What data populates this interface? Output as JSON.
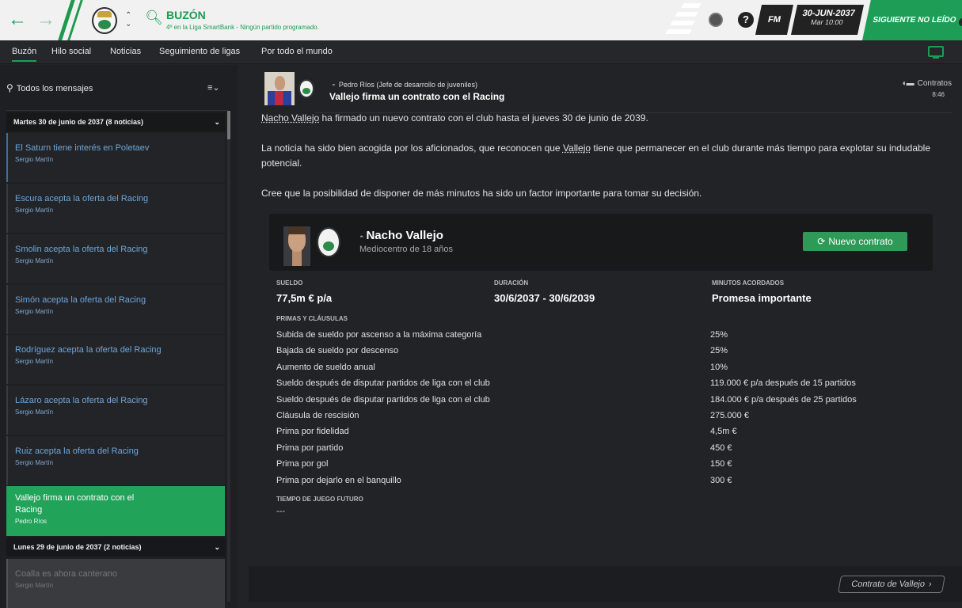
{
  "topbar": {
    "title": "BUZÓN",
    "subtitle": "4º en la Liga SmartBank - Ningún partido programado.",
    "fm_label": "FM",
    "date": "30-JUN-2037",
    "time": "Mar 10:00",
    "next_label": "SIGUIENTE NO LEÍDO",
    "accent": "#1a9e52"
  },
  "tabs": [
    {
      "label": "Buzón"
    },
    {
      "label": "Hilo social"
    },
    {
      "label": "Noticias"
    },
    {
      "label": "Seguimiento de ligas"
    },
    {
      "label": "Por todo el mundo"
    }
  ],
  "sidebar": {
    "filter": "Todos los mensajes",
    "groups": [
      {
        "label": "Martes 30 de junio de 2037 (8 noticias)"
      },
      {
        "label": "Lunes 29 de junio de 2037 (2 noticias)"
      }
    ],
    "messages": [
      {
        "title": "El Saturn tiene interés en Poletaev",
        "sender": "Sergio Martín"
      },
      {
        "title": "Escura acepta la oferta del Racing",
        "sender": "Sergio Martín"
      },
      {
        "title": "Smolin acepta la oferta del Racing",
        "sender": "Sergio Martín"
      },
      {
        "title": "Simón acepta la oferta del Racing",
        "sender": "Sergio Martín"
      },
      {
        "title": "Rodríguez acepta la oferta del Racing",
        "sender": "Sergio Martín"
      },
      {
        "title": "Lázaro acepta la oferta del Racing",
        "sender": "Sergio Martín"
      },
      {
        "title": "Ruiz acepta la oferta del Racing",
        "sender": "Sergio Martín"
      },
      {
        "title": "Vallejo firma un contrato con el Racing",
        "sender": "Pedro Ríos"
      },
      {
        "title": "Coalla es ahora canterano",
        "sender": "Sergio Martín"
      }
    ]
  },
  "mail": {
    "sender": "Pedro Ríos  (Jefe de desarrollo de juveniles)",
    "title": "Vallejo firma un contrato con el Racing",
    "tag": "Contratos",
    "time": "8:46",
    "p1_name": "Nacho Vallejo",
    "p1_rest": " ha firmado un nuevo contrato con el club hasta el jueves 30 de junio de 2039.",
    "p2_a": "La noticia ha sido bien acogida por los aficionados, que reconocen que ",
    "p2_name": "Vallejo",
    "p2_b": " tiene que permanecer en el club durante más tiempo para explotar su indudable potencial.",
    "p3": "Cree que la posibilidad de disponer de más minutos ha sido un factor importante para tomar su decisión."
  },
  "contract": {
    "player": "Nacho Vallejo",
    "position": "Mediocentro de 18 años",
    "button": "Nuevo contrato",
    "sueldo_label": "SUELDO",
    "sueldo": "77,5m € p/a",
    "duracion_label": "DURACIÓN",
    "duracion": "30/6/2037 - 30/6/2039",
    "minutos_label": "MINUTOS ACORDADOS",
    "minutos": "Promesa importante",
    "primas_label": "PRIMAS Y CLÁUSULAS",
    "clauses": [
      {
        "name": "Subida de sueldo por ascenso a la máxima categoría",
        "value": "25%"
      },
      {
        "name": "Bajada de sueldo por descenso",
        "value": "25%"
      },
      {
        "name": "Aumento de sueldo anual",
        "value": "10%"
      },
      {
        "name": "Sueldo después de disputar partidos de liga con el club",
        "value": "119.000 € p/a después de 15 partidos"
      },
      {
        "name": "Sueldo después de disputar partidos de liga con el club",
        "value": "184.000 € p/a después de 25 partidos"
      },
      {
        "name": "Cláusula de rescisión",
        "value": "275.000 €"
      },
      {
        "name": "Prima por fidelidad",
        "value": "4,5m €"
      },
      {
        "name": "Prima por partido",
        "value": "450 €"
      },
      {
        "name": "Prima por gol",
        "value": "150 €"
      },
      {
        "name": "Prima por dejarlo en el banquillo",
        "value": "300 €"
      }
    ],
    "tiempo_label": "TIEMPO DE JUEGO FUTURO",
    "tiempo": "---",
    "link": "Contrato de Vallejo"
  }
}
